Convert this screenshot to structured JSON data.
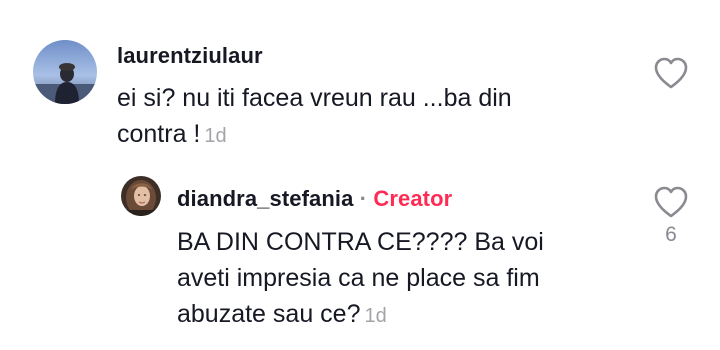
{
  "comments": [
    {
      "username": "laurentziulaur",
      "text_line1": "ei si? nu iti facea vreun rau ...ba din",
      "text_line2": "contra !",
      "time": "1d"
    }
  ],
  "reply": {
    "username": "diandra_stefania",
    "separator": "·",
    "badge": "Creator",
    "text_line1": "BA DIN CONTRA CE???? Ba voi",
    "text_line2": "aveti impresia ca ne place sa fim",
    "text_line3": "abuzate sau ce?",
    "time": "1d",
    "like_count": "6"
  },
  "icons": {
    "like": "heart-outline-icon"
  },
  "colors": {
    "creator_badge": "#fe2c55",
    "timestamp": "#a3a4a8",
    "text": "#161823"
  }
}
